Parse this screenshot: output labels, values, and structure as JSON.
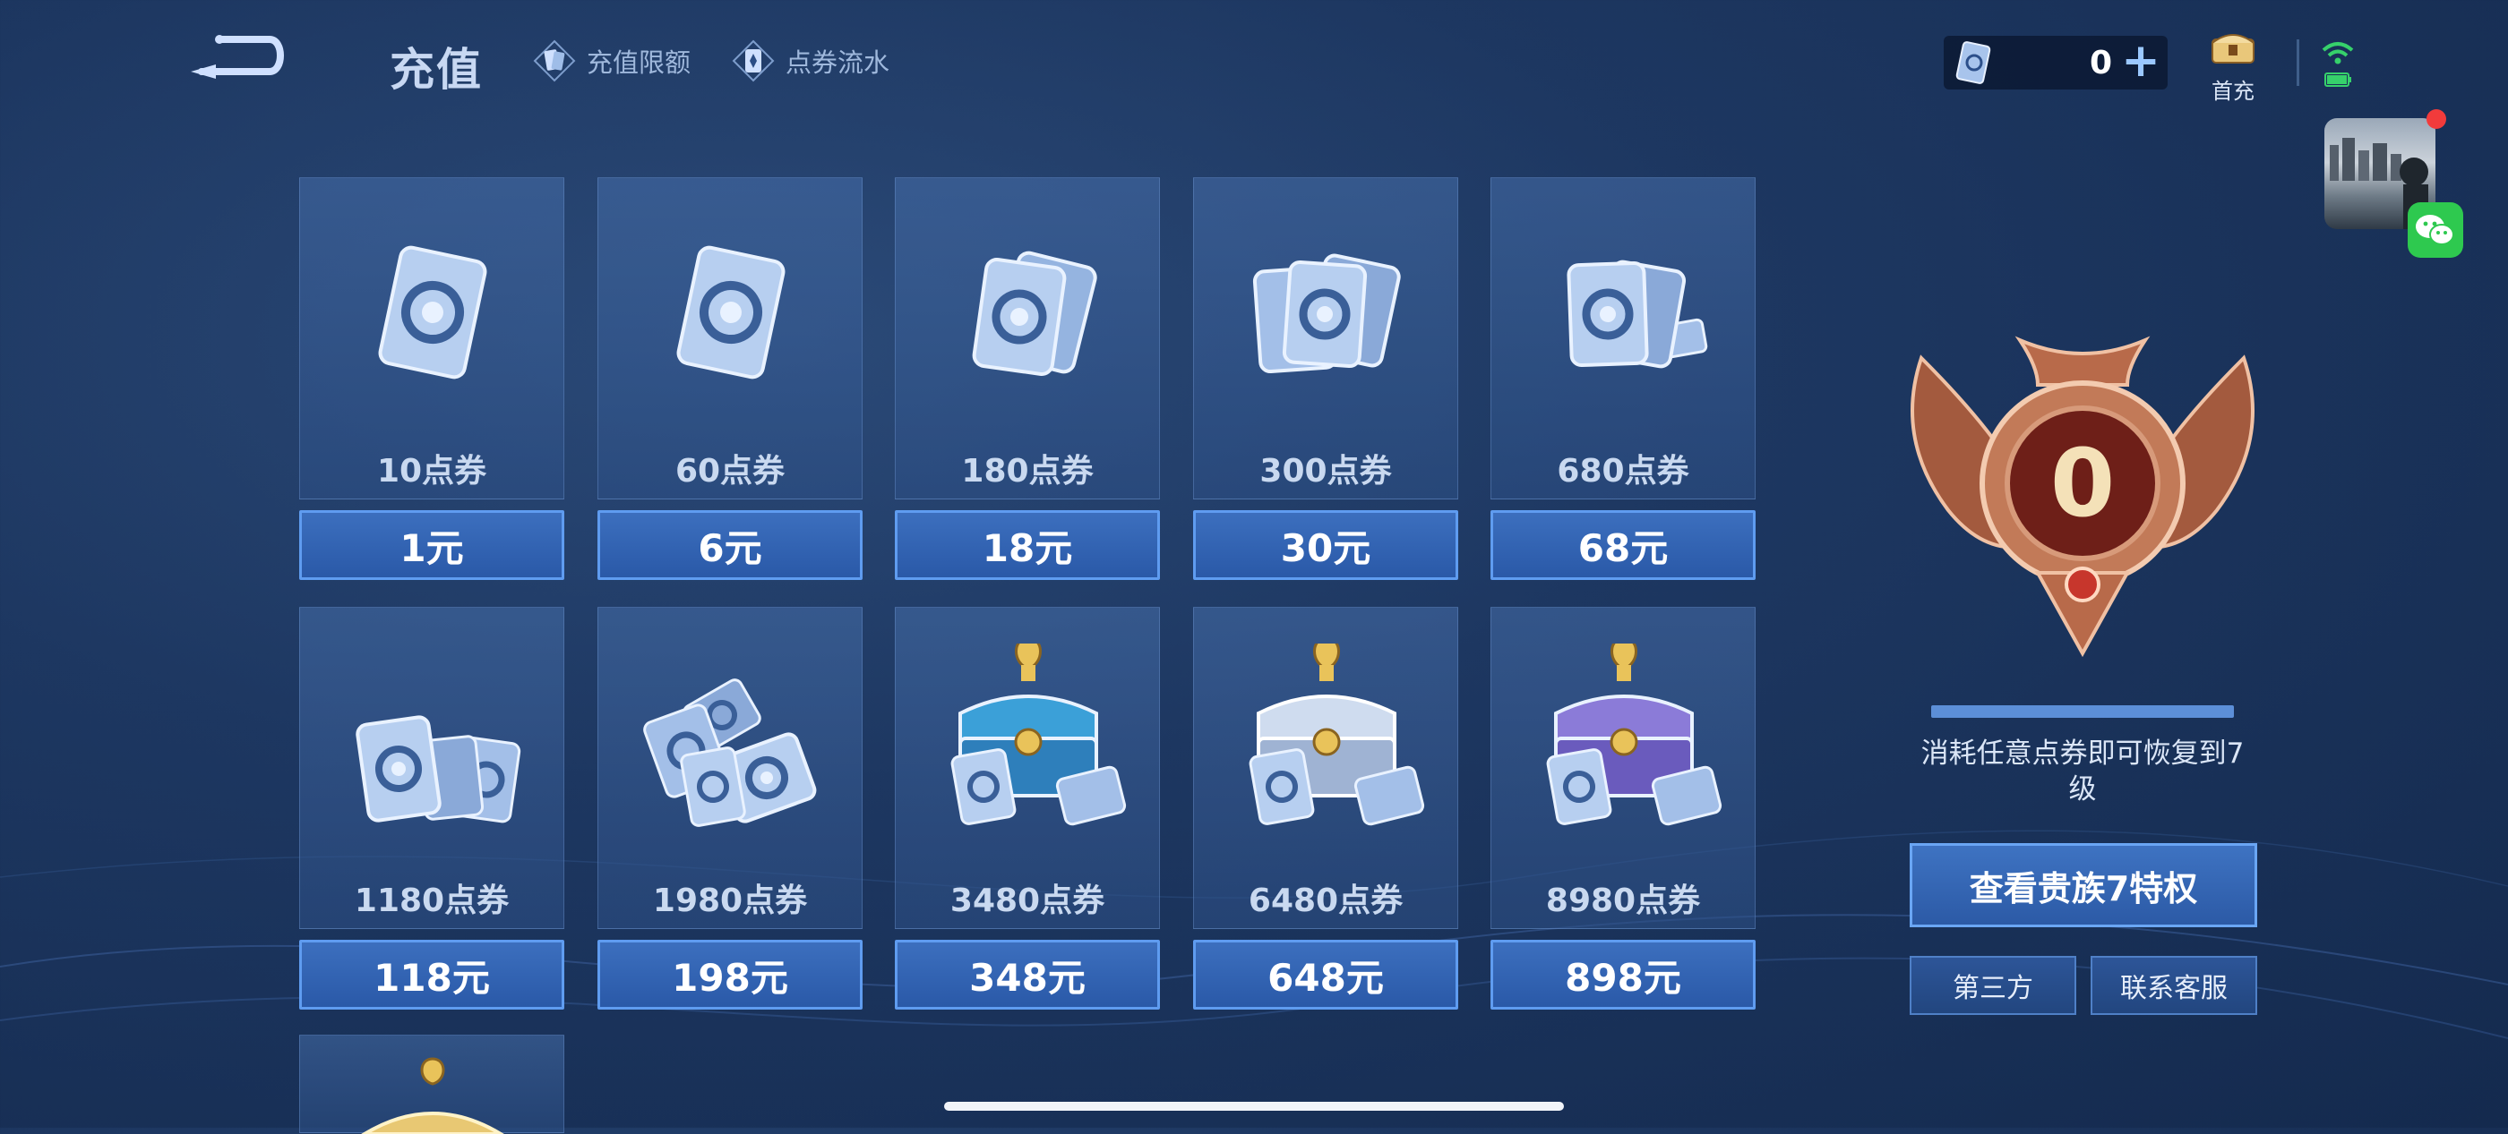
{
  "header": {
    "title": "充值",
    "link_limit": "充值限额",
    "link_flow": "点券流水"
  },
  "currency": {
    "value": "0"
  },
  "first_charge": {
    "label": "首充"
  },
  "packs": [
    {
      "amount": "10点券",
      "price": "1元",
      "icon": "single-coupon-icon"
    },
    {
      "amount": "60点券",
      "price": "6元",
      "icon": "single-coupon-icon"
    },
    {
      "amount": "180点券",
      "price": "18元",
      "icon": "two-coupons-icon"
    },
    {
      "amount": "300点券",
      "price": "30元",
      "icon": "three-coupons-icon"
    },
    {
      "amount": "680点券",
      "price": "68元",
      "icon": "coupon-stack-icon"
    },
    {
      "amount": "1180点券",
      "price": "118元",
      "icon": "coupon-pile-icon"
    },
    {
      "amount": "1980点券",
      "price": "198元",
      "icon": "coupon-heap-icon"
    },
    {
      "amount": "3480点券",
      "price": "348元",
      "icon": "blue-chest-icon"
    },
    {
      "amount": "6480点券",
      "price": "648元",
      "icon": "silver-chest-icon"
    },
    {
      "amount": "8980点券",
      "price": "898元",
      "icon": "purple-chest-icon"
    }
  ],
  "vip": {
    "level": "0",
    "description": "消耗任意点券即可恢复到7级",
    "privilege_button": "查看贵族7特权",
    "third_party_button": "第三方",
    "service_button": "联系客服"
  },
  "colors": {
    "background": "#1d3761",
    "price_button": "#2a59a8",
    "price_border": "#5f9cf0",
    "badge_bronze": "#b86a4a",
    "wechat_green": "#2ec94f"
  }
}
